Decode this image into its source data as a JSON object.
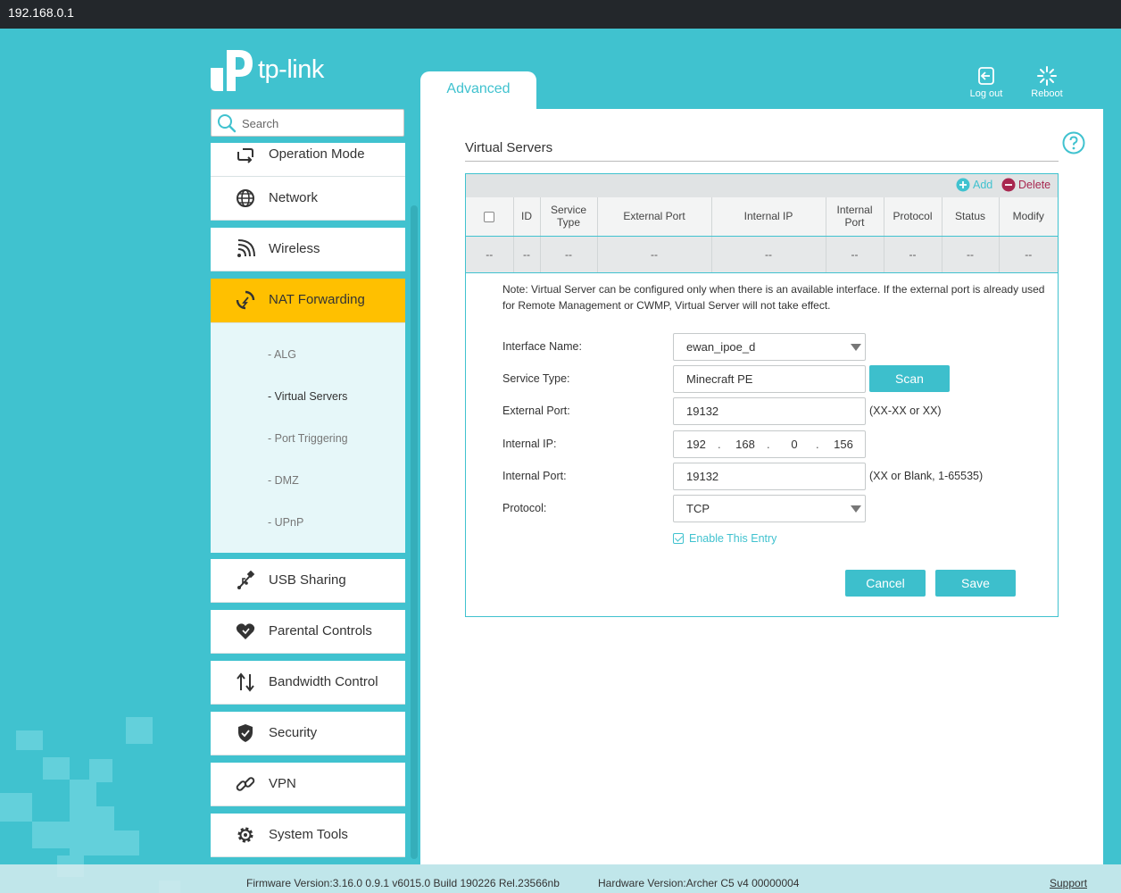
{
  "window": {
    "title": "192.168.0.1"
  },
  "brand": {
    "logo_text": "tp-link"
  },
  "search": {
    "placeholder": "Search"
  },
  "tab": {
    "label": "Advanced"
  },
  "header": {
    "logout_label": "Log out",
    "reboot_label": "Reboot"
  },
  "sidebar": {
    "items": [
      {
        "label": "Operation Mode",
        "icon": "operation-mode-icon"
      },
      {
        "label": "Network",
        "icon": "globe-icon"
      },
      {
        "label": "Wireless",
        "icon": "wifi-icon"
      },
      {
        "label": "NAT Forwarding",
        "icon": "nat-icon",
        "active": true
      },
      {
        "label": "USB Sharing",
        "icon": "usb-icon"
      },
      {
        "label": "Parental Controls",
        "icon": "heart-icon"
      },
      {
        "label": "Bandwidth Control",
        "icon": "updown-arrows-icon"
      },
      {
        "label": "Security",
        "icon": "shield-icon"
      },
      {
        "label": "VPN",
        "icon": "link-icon"
      },
      {
        "label": "System Tools",
        "icon": "gear-icon"
      }
    ],
    "submenu": [
      {
        "label": "- ALG"
      },
      {
        "label": "- Virtual Servers",
        "active": true
      },
      {
        "label": "- Port Triggering"
      },
      {
        "label": "- DMZ"
      },
      {
        "label": "- UPnP"
      }
    ]
  },
  "section": {
    "title": "Virtual Servers"
  },
  "toolbar": {
    "add_label": "Add",
    "delete_label": "Delete"
  },
  "table": {
    "headers": [
      "ID",
      "Service\nType",
      "External Port",
      "Internal IP",
      "Internal\nPort",
      "Protocol",
      "Status",
      "Modify"
    ],
    "row": [
      "--",
      "--",
      "--",
      "--",
      "--",
      "--",
      "--",
      "--",
      "--"
    ]
  },
  "note": "Note: Virtual Server can be configured only when there is an available interface. If the external port is already used for Remote Management or CWMP, Virtual Server will not take effect.",
  "form": {
    "interface_label": "Interface Name:",
    "interface_value": "ewan_ipoe_d",
    "service_type_label": "Service Type:",
    "service_type_value": "Minecraft PE",
    "scan_label": "Scan",
    "external_port_label": "External Port:",
    "external_port_value": "19132",
    "external_port_hint": "(XX-XX or XX)",
    "internal_ip_label": "Internal IP:",
    "internal_ip": [
      "192",
      "168",
      "0",
      "156"
    ],
    "internal_port_label": "Internal Port:",
    "internal_port_value": "19132",
    "internal_port_hint": "(XX or Blank, 1-65535)",
    "protocol_label": "Protocol:",
    "protocol_value": "TCP",
    "enable_label": "Enable This Entry",
    "enable_checked": true,
    "cancel_label": "Cancel",
    "save_label": "Save"
  },
  "footer": {
    "firmware": "Firmware Version:3.16.0 0.9.1 v6015.0 Build 190226 Rel.23566nb",
    "hardware": "Hardware Version:Archer C5 v4 00000004",
    "support": "Support"
  },
  "colors": {
    "accent": "#40c2cf",
    "active_nav": "#ffc000",
    "delete": "#a8274f",
    "topbar": "#23272b"
  }
}
